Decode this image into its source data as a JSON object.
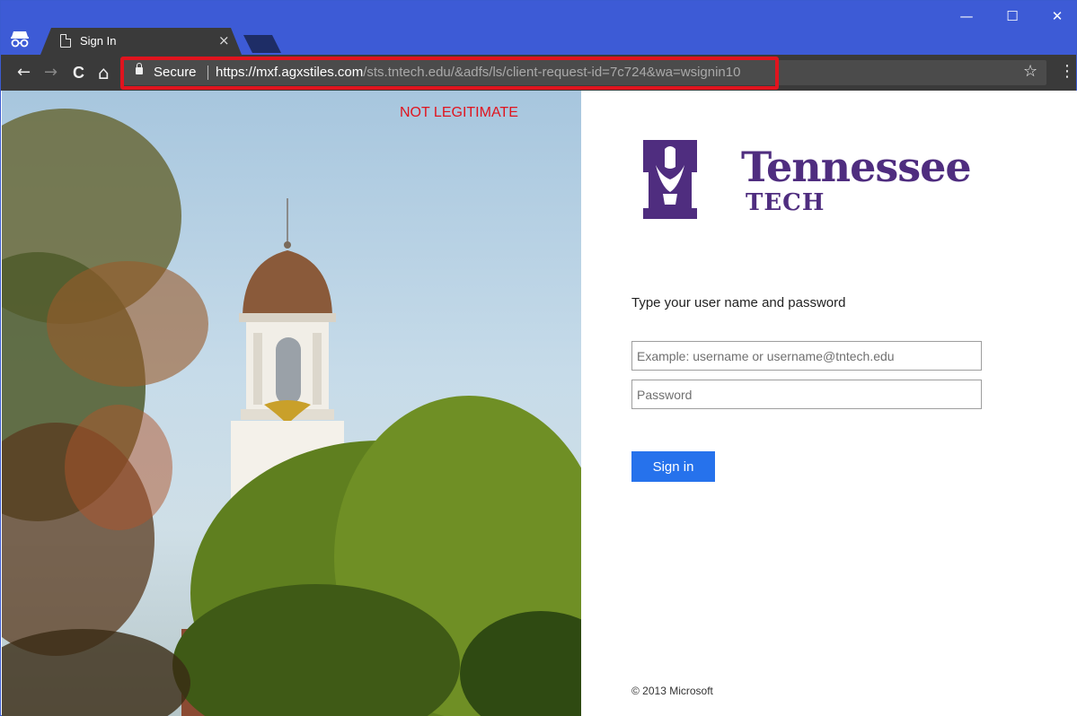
{
  "browser": {
    "tab": {
      "title": "Sign In",
      "close_glyph": "×"
    },
    "window_controls": {
      "minimize": "—",
      "maximize": "☐",
      "close": "✕"
    },
    "nav": {
      "back": "←",
      "forward": "→",
      "reload": "C",
      "home": "⌂"
    },
    "address_bar": {
      "security_label": "Secure",
      "url_host": "https://mxf.agxstiles.com",
      "url_path": "/sts.tntech.edu/&adfs/ls/client-request-id=7c724&wa=wsignin10",
      "bookmark_glyph": "☆",
      "menu_glyph": "⋮"
    },
    "highlight_color": "#e0141e"
  },
  "annotation": {
    "warning": "NOT LEGITIMATE"
  },
  "brand": {
    "name": "Tennessee",
    "sub": "TECH",
    "color": "#4f2d7f"
  },
  "login": {
    "prompt": "Type your user name and password",
    "username_placeholder": "Example: username or username@tntech.edu",
    "password_placeholder": "Password",
    "submit_label": "Sign in",
    "footer": "© 2013 Microsoft",
    "accent": "#2672ec"
  },
  "icons": [
    "incognito-icon",
    "document-icon",
    "lock-icon",
    "star-icon",
    "kebab-menu-icon"
  ]
}
